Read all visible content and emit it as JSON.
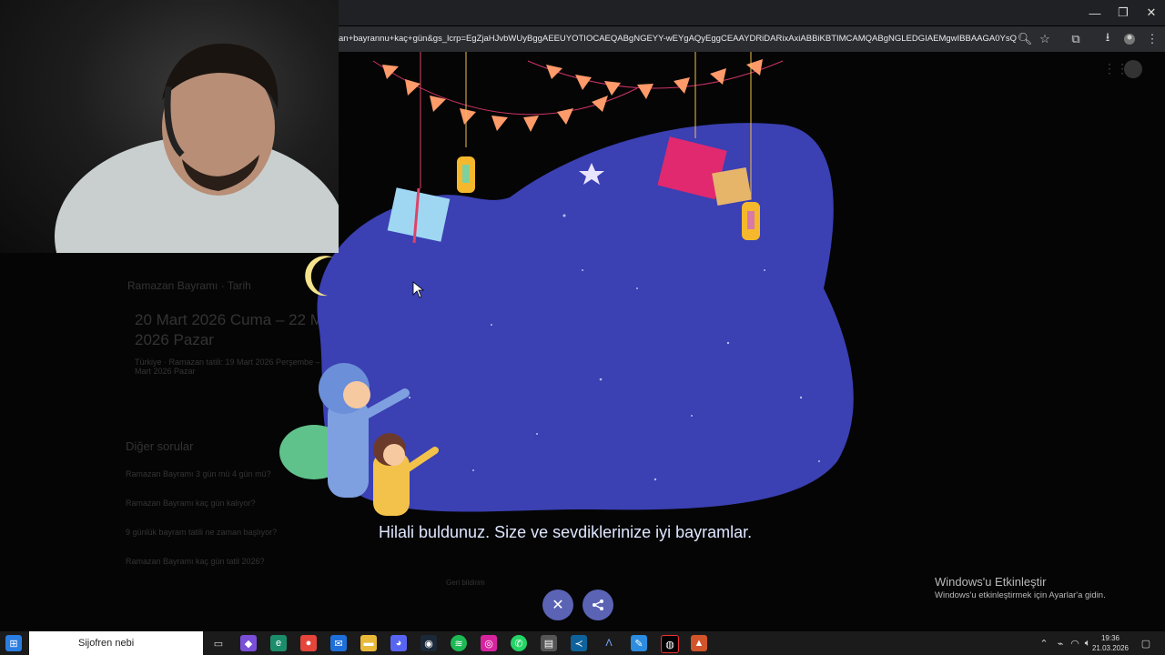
{
  "browser": {
    "url": "an+bayrannu+kaç+gün&gs_lcrp=EgZjaHJvbWUyBggAEEUYOTIOCAEQABgNGEYY-wEYgAQyEggCEAAYDRiDARixAxiABBiKBTIMCAMQABgNGLEDGIAEMgwIBBAAGA0YsQMYgAQyD...",
    "window_controls": [
      "—",
      "❐",
      "✕"
    ]
  },
  "background_results": {
    "source_label": "Ramazan Bayramı · Tarih",
    "answer": "20 Mart 2026 Cuma – 22 Mart 2026 Pazar",
    "answer_sub": "Türkiye · Ramazan tatili: 19 Mart 2026 Perşembe – 22 Mart 2026 Pazar",
    "questions_title": "Diğer sorular",
    "questions": [
      "Ramazan Bayramı 3 gün mü 4 gün mü?",
      "Ramazan Bayramı kaç gün kalıyor?",
      "9 günlük bayram tatili ne zaman başlıyor?",
      "Ramazan Bayramı kaç gün tatil 2026?"
    ],
    "feedback": "Geri bildirim"
  },
  "doodle": {
    "message": "Hilali buldunuz. Size ve sevdiklerinize iyi bayramlar.",
    "close_label": "✕",
    "share_label": "⋖"
  },
  "activation": {
    "title": "Windows'u Etkinleştir",
    "subtitle": "Windows'u etkinleştirmek için Ayarlar'a gidin."
  },
  "taskbar": {
    "search_text": "Sijofren nebi",
    "time": "19:36",
    "date": "21.03.2026"
  },
  "colors": {
    "blob": "#3a3fb0",
    "button": "#5b63b5",
    "taskbar": "#1b1b1b"
  }
}
